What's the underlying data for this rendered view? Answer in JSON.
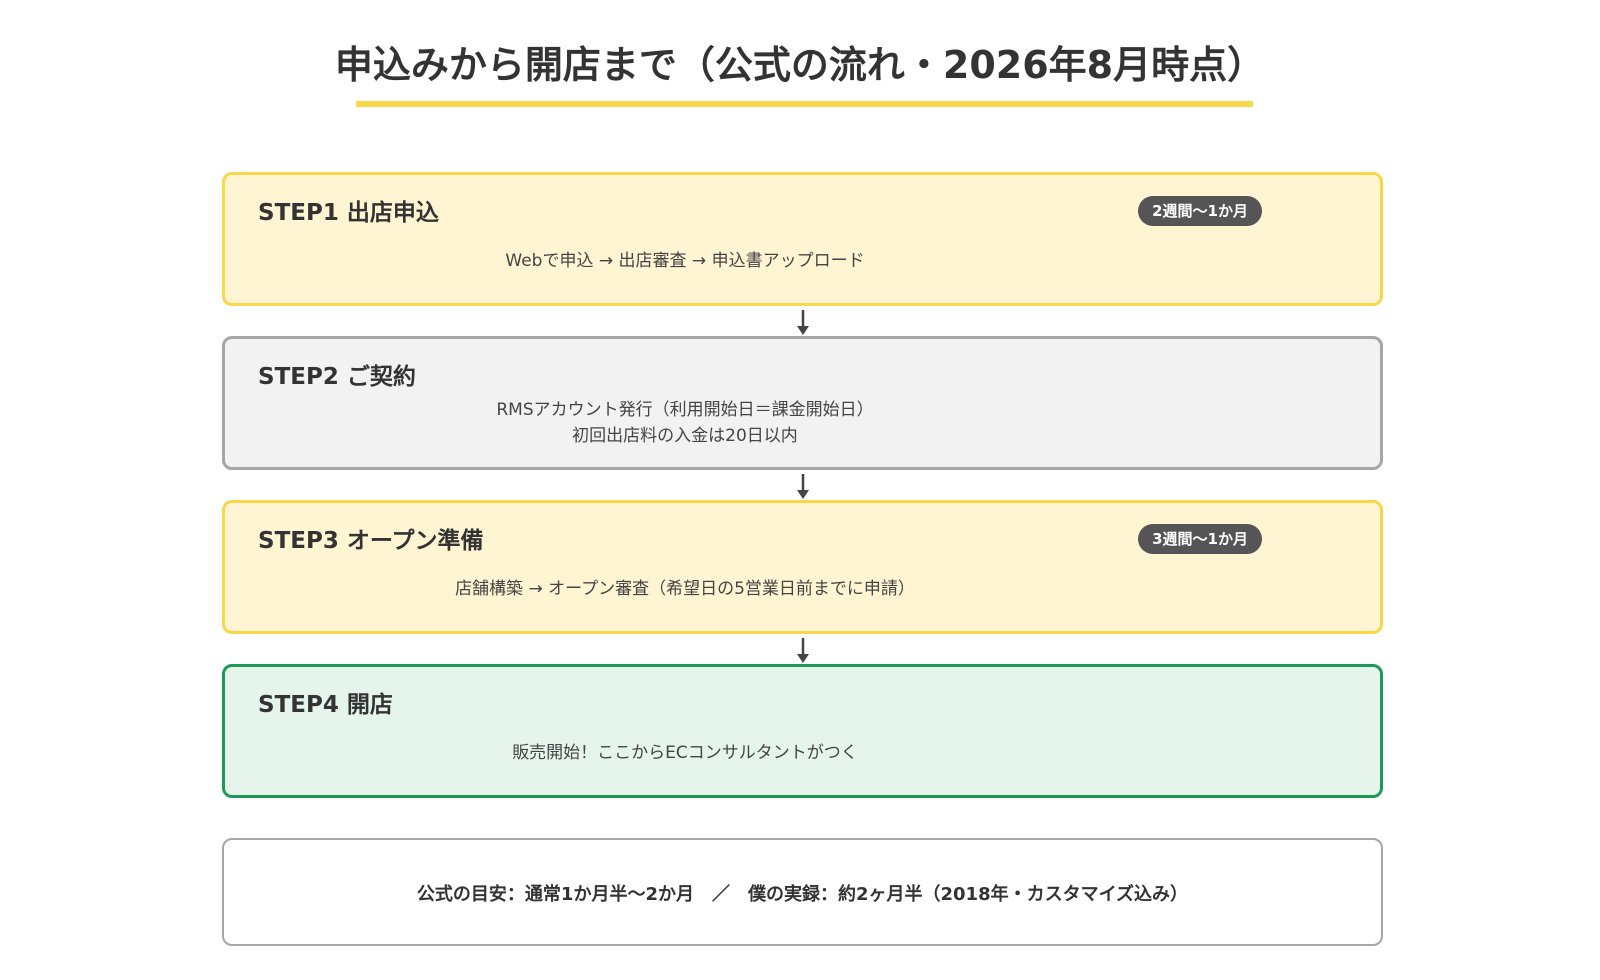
{
  "title": "申込みから開店まで（公式の流れ・2026年8月時点）",
  "colors": {
    "accent_yellow": "#F8D74A",
    "yellow_fill": "#FFF5D3",
    "gray_border": "#A6A6A6",
    "gray_fill": "#F2F2F2",
    "green_border": "#1E9A58",
    "green_fill": "#E6F5EC",
    "badge": "#555555"
  },
  "steps": [
    {
      "title": "STEP1  出店申込",
      "badge": "2週間〜1か月",
      "lines": [
        "Webで申込 → 出店審査 → 申込書アップロード"
      ]
    },
    {
      "title": "STEP2  ご契約",
      "lines": [
        "RMSアカウント発行（利用開始日＝課金開始日）",
        "初回出店料の入金は20日以内"
      ]
    },
    {
      "title": "STEP3  オープン準備",
      "badge": "3週間〜1か月",
      "lines": [
        "店舗構築 → オープン審査（希望日の5営業日前までに申請）"
      ]
    },
    {
      "title": "STEP4  開店",
      "lines": [
        "販売開始！ここからECコンサルタントがつく"
      ]
    }
  ],
  "summary": "公式の目安：通常1か月半〜2か月　／　僕の実録：約2ヶ月半（2018年・カスタマイズ込み）"
}
